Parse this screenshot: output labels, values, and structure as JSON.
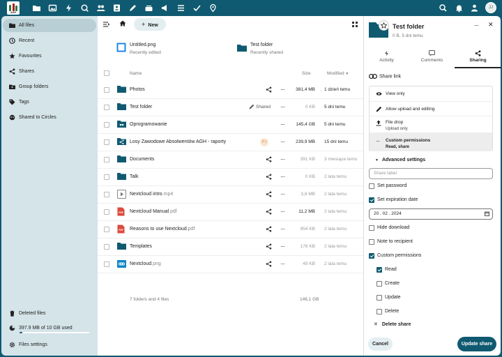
{
  "app": {
    "logo_text": "AGH",
    "user_initials": "JJ",
    "accent": "#0f5a70"
  },
  "topnav": {
    "icons": [
      "files-icon",
      "photos-icon",
      "activity-icon",
      "search-circle-icon",
      "contacts-icon",
      "notes-icon",
      "deck-icon",
      "announcements-icon",
      "tasks-icon",
      "check-icon",
      "maps-icon"
    ],
    "right_icons": [
      "search-icon",
      "notifications-icon",
      "contacts-menu-icon"
    ]
  },
  "sidebar": {
    "items": [
      {
        "label": "All files",
        "icon": "folder-icon"
      },
      {
        "label": "Recent",
        "icon": "clock-icon"
      },
      {
        "label": "Favourites",
        "icon": "star-icon"
      },
      {
        "label": "Shares",
        "icon": "share-icon"
      },
      {
        "label": "Group folders",
        "icon": "group-folder-icon"
      },
      {
        "label": "Tags",
        "icon": "tag-icon"
      },
      {
        "label": "Shared to Circles",
        "icon": "circles-icon"
      }
    ],
    "deleted": "Deleted files",
    "quota": "397.9 MB of 10 GB used",
    "quota_fraction": 0.04,
    "settings": "Files settings"
  },
  "toolbar": {
    "new_label": "New"
  },
  "recent": [
    {
      "name": "Untitled.png",
      "sub": "Recently edited",
      "icon": "image-icon"
    },
    {
      "name": "Test folder",
      "sub": "Recently shared",
      "icon": "folder-icon"
    }
  ],
  "table": {
    "headers": {
      "name": "Name",
      "size": "Size",
      "modified": "Modified"
    },
    "rows": [
      {
        "base": "Photos",
        "ext": "",
        "icon": "folder",
        "share": "share-icon",
        "size": "381,4 MB",
        "modified": "1 dzień temu",
        "size_dark": true,
        "mod_dark": true
      },
      {
        "base": "Test folder",
        "ext": "",
        "icon": "folder",
        "share": "shared",
        "share_label": "Shared",
        "size": "0 KB",
        "modified": "5 dni temu",
        "size_dark": false,
        "mod_dark": true
      },
      {
        "base": "Oprogramowanie",
        "ext": "",
        "icon": "group-folder",
        "share": "",
        "size": "145,4 GB",
        "modified": "5 dni temu",
        "size_dark": true,
        "mod_dark": true
      },
      {
        "base": "Losy Zawodowe Absolwentów AGH - raporty",
        "ext": "",
        "icon": "share-folder",
        "share": "avatar",
        "avatar": "PJ",
        "size": "239,9 MB",
        "modified": "15 dni temu",
        "size_dark": true,
        "mod_dark": true
      },
      {
        "base": "Documents",
        "ext": "",
        "icon": "folder",
        "share": "share-icon",
        "size": "391 KB",
        "modified": "3 miesiące temu",
        "size_dark": false,
        "mod_dark": false
      },
      {
        "base": "Talk",
        "ext": "",
        "icon": "folder",
        "share": "share-icon",
        "size": "0 KB",
        "modified": "2 lata temu",
        "size_dark": false,
        "mod_dark": false
      },
      {
        "base": "Nextcloud intro",
        "ext": ".mp4",
        "icon": "video",
        "share": "share-icon",
        "size": "3,8 MB",
        "modified": "2 lata temu",
        "size_dark": false,
        "mod_dark": false
      },
      {
        "base": "Nextcloud Manual",
        "ext": ".pdf",
        "icon": "pdf",
        "share": "share-icon",
        "size": "11,2 MB",
        "modified": "2 lata temu",
        "size_dark": true,
        "mod_dark": false
      },
      {
        "base": "Reasons to use Nextcloud",
        "ext": ".pdf",
        "icon": "pdf",
        "share": "share-icon",
        "size": "954 KB",
        "modified": "2 lata temu",
        "size_dark": false,
        "mod_dark": false
      },
      {
        "base": "Templates",
        "ext": "",
        "icon": "folder",
        "share": "share-icon",
        "size": "178 KB",
        "modified": "2 lata temu",
        "size_dark": false,
        "mod_dark": false
      },
      {
        "base": "Nextcloud",
        "ext": ".png",
        "icon": "image",
        "share": "share-icon",
        "size": "49 KB",
        "modified": "2 lata temu",
        "size_dark": false,
        "mod_dark": false
      }
    ],
    "summary_count": "7 folders and 4 files",
    "summary_size": "146,1 GB"
  },
  "panel": {
    "title": "Test folder",
    "subtitle": "0 B, 5 dni temu",
    "tabs": [
      {
        "label": "Activity",
        "icon": "activity-icon"
      },
      {
        "label": "Comments",
        "icon": "comment-icon"
      },
      {
        "label": "Sharing",
        "icon": "share-icon"
      }
    ],
    "share_link": "Share link",
    "menu": [
      {
        "label": "View only",
        "icon": "eye-icon"
      },
      {
        "label": "Allow upload and editing",
        "icon": "pencil-icon"
      },
      {
        "label": "File drop",
        "sub": "Upload only",
        "icon": "upload-icon"
      },
      {
        "label": "Custom permissions",
        "sub": "Read, share",
        "icon": "dots-icon"
      }
    ],
    "advanced": "Advanced settings",
    "share_label_placeholder": "Share label",
    "set_password": "Set password",
    "set_expiration": "Set expiration date",
    "expiration_date": "20 . 02 . 2024",
    "hide_download": "Hide download",
    "note": "Note to recipient",
    "custom_perms": "Custom permissions",
    "perm_read": "Read",
    "perm_create": "Create",
    "perm_update": "Update",
    "perm_delete": "Delete",
    "delete_share": "Delete share",
    "cancel": "Cancel",
    "update": "Update share"
  }
}
